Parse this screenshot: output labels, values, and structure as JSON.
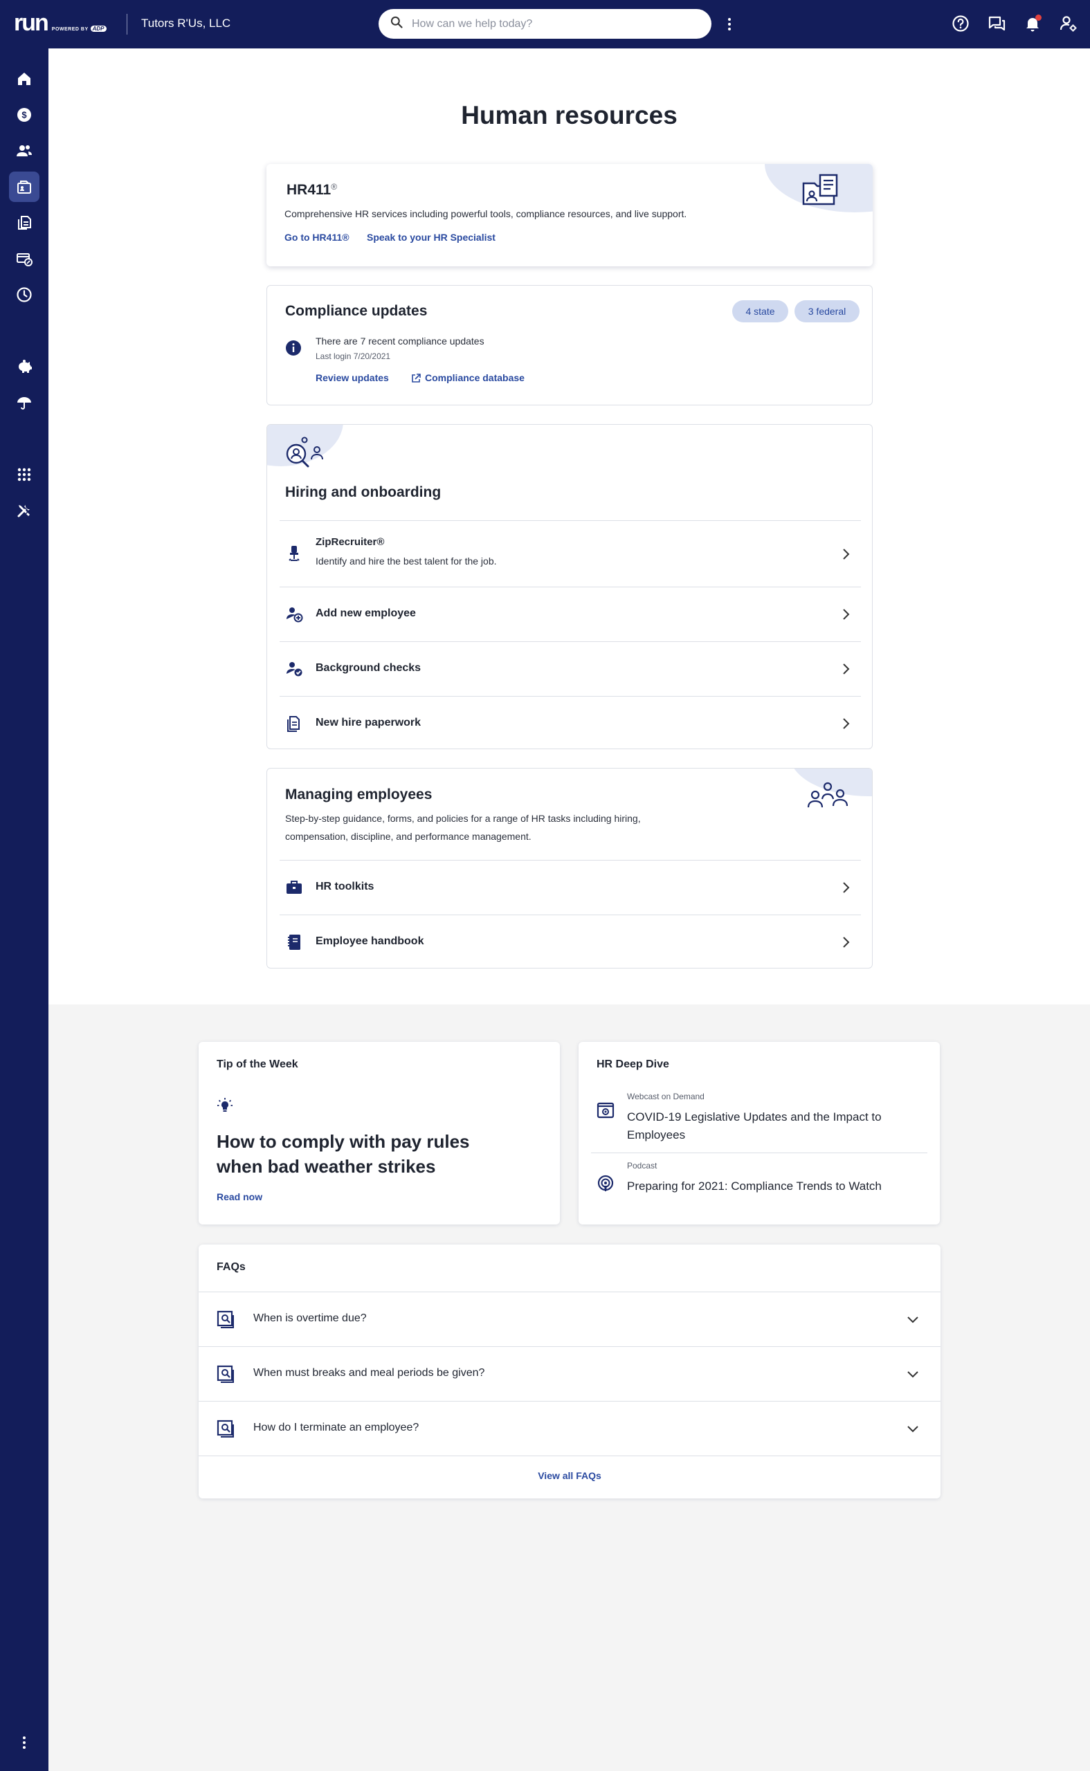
{
  "header": {
    "logo_text": "run",
    "logo_powered": "POWERED BY",
    "logo_brand": "ADP",
    "company": "Tutors R'Us, LLC",
    "search_placeholder": "How can we help today?",
    "icons": [
      "help-icon",
      "chat-icon",
      "bell-icon",
      "user-settings-icon"
    ],
    "notification_dot_color": "#e2433f"
  },
  "sidebar": {
    "items": [
      {
        "name": "home-icon",
        "active": false
      },
      {
        "name": "payroll-icon",
        "active": false
      },
      {
        "name": "people-icon",
        "active": false
      },
      {
        "name": "hr-icon",
        "active": true
      },
      {
        "name": "reports-icon",
        "active": false
      },
      {
        "name": "taxes-icon",
        "active": false
      },
      {
        "name": "time-icon",
        "active": false
      },
      {
        "name": "retirement-icon",
        "active": false
      },
      {
        "name": "insurance-icon",
        "active": false
      },
      {
        "name": "apps-icon",
        "active": false
      },
      {
        "name": "tools-icon",
        "active": false
      }
    ]
  },
  "colors": {
    "nav": "#131d5a",
    "accent": "#2a4aa0",
    "pill": "#cfd9f0",
    "active_nav": "#3a4a93"
  },
  "page": {
    "title": "Human resources"
  },
  "hr411": {
    "title": "HR411",
    "reg": "®",
    "description": "Comprehensive HR services including powerful tools, compliance resources, and live support.",
    "link1": "Go to HR411®",
    "link2": "Speak to your HR Specialist"
  },
  "compliance": {
    "title": "Compliance updates",
    "pill_state": "4 state",
    "pill_federal": "3 federal",
    "message": "There are 7 recent compliance updates",
    "last_login": "Last login 7/20/2021",
    "link_review": "Review updates",
    "link_database": "Compliance database"
  },
  "hiring": {
    "title": "Hiring and onboarding",
    "rows": [
      {
        "title": "ZipRecruiter®",
        "subtitle": "Identify and hire the best talent for the job.",
        "icon": "chair-icon"
      },
      {
        "title": "Add new employee",
        "icon": "add-person-icon"
      },
      {
        "title": "Background checks",
        "icon": "person-check-icon"
      },
      {
        "title": "New hire paperwork",
        "icon": "document-icon"
      }
    ]
  },
  "managing": {
    "title": "Managing employees",
    "description_line1": "Step-by-step guidance, forms, and policies for a range of HR tasks including hiring,",
    "description_line2": "compensation, discipline, and performance management.",
    "rows": [
      {
        "title": "HR toolkits",
        "icon": "briefcase-icon"
      },
      {
        "title": "Employee handbook",
        "icon": "handbook-icon"
      }
    ]
  },
  "tip": {
    "label": "Tip of the Week",
    "headline_line1": "How to comply with pay rules",
    "headline_line2": "when bad weather strikes",
    "link": "Read now"
  },
  "deep_dive": {
    "label": "HR Deep Dive",
    "items": [
      {
        "kind": "Webcast on Demand",
        "title_line1": "COVID-19 Legislative Updates and the Impact to",
        "title_line2": "Employees"
      },
      {
        "kind": "Podcast",
        "title_line1": "Preparing for 2021: Compliance Trends to Watch"
      }
    ]
  },
  "faqs": {
    "label": "FAQs",
    "items": [
      "When is overtime due?",
      "When must breaks and meal periods be given?",
      "How do I terminate an employee?"
    ],
    "view_all": "View all FAQs"
  }
}
